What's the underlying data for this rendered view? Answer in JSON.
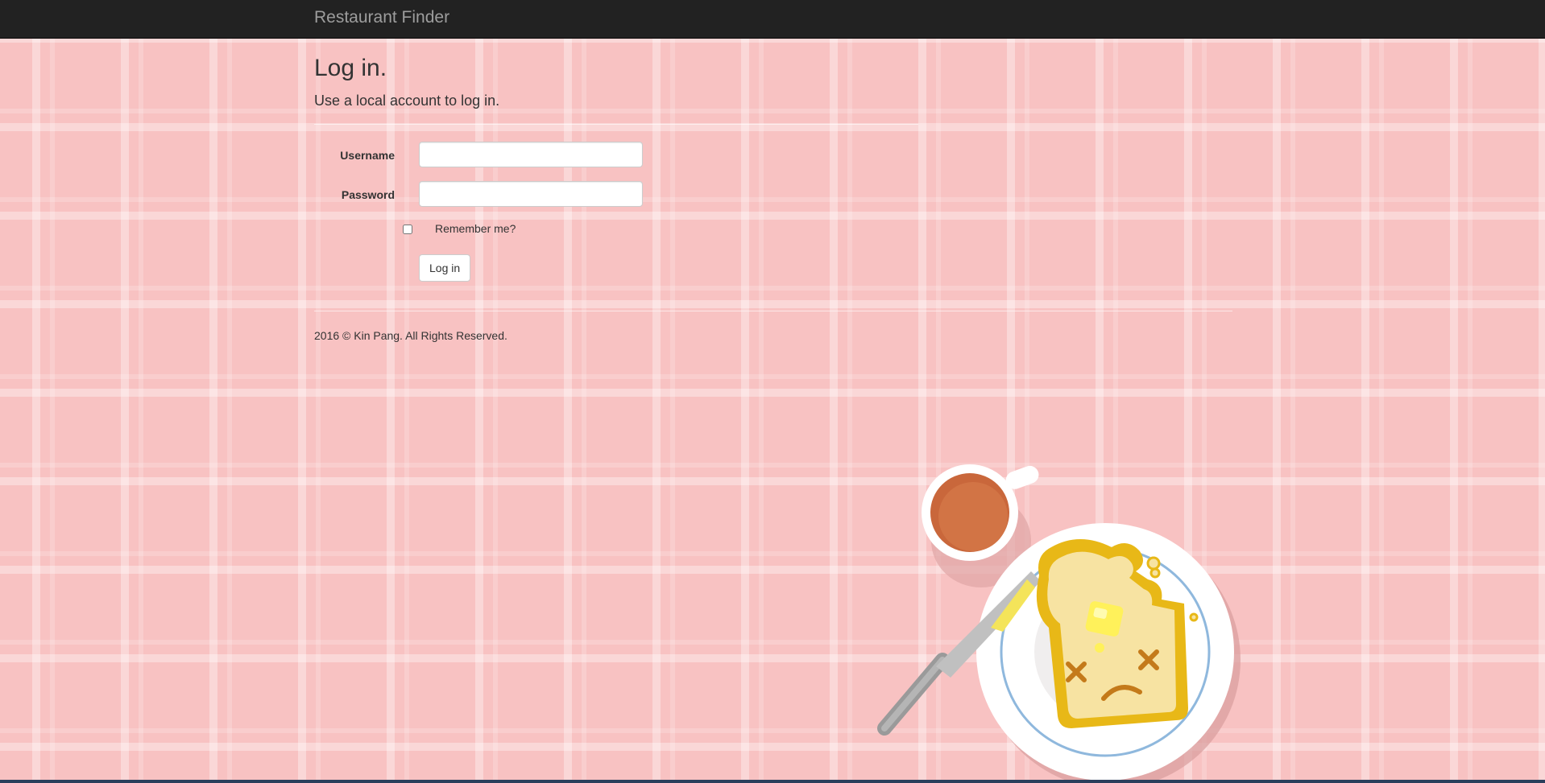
{
  "navbar": {
    "brand": "Restaurant Finder"
  },
  "page": {
    "title": "Log in.",
    "subtitle": "Use a local account to log in."
  },
  "form": {
    "username_label": "Username",
    "username_value": "",
    "password_label": "Password",
    "password_value": "",
    "remember_label": "Remember me?",
    "remember_checked": false,
    "submit_label": "Log in"
  },
  "footer": {
    "text": "2016 © Kin Pang. All Rights Reserved."
  },
  "colors": {
    "background": "#f8c2c2",
    "navbar": "#222222",
    "brand_text": "#9d9d9d",
    "text": "#333333"
  },
  "illustration": {
    "name": "sad-toast-breakfast-illustration"
  }
}
